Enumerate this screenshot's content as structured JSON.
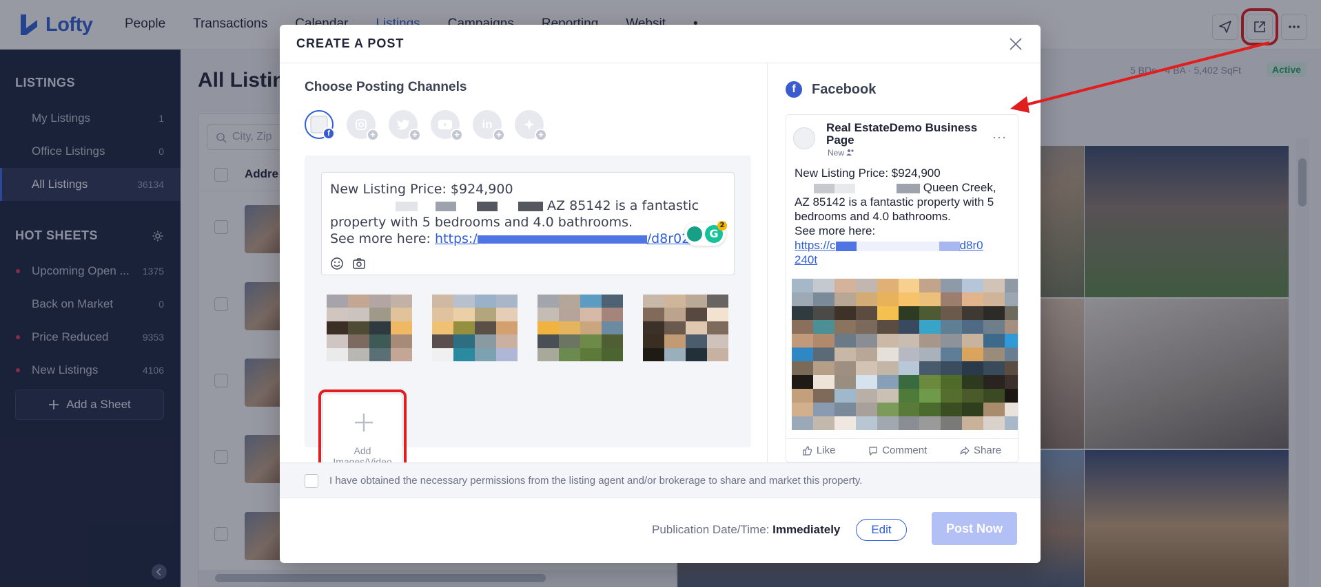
{
  "app": {
    "logo": "Lofty",
    "nav": [
      "People",
      "Transactions",
      "Calendar",
      "Listings",
      "Campaigns",
      "Reporting",
      "Websit"
    ],
    "nav_active": "Listings",
    "nav_more": "•"
  },
  "sidebar": {
    "listings_title": "LISTINGS",
    "listings": [
      {
        "label": "My Listings",
        "count": "1"
      },
      {
        "label": "Office Listings",
        "count": "0"
      },
      {
        "label": "All Listings",
        "count": "36134"
      }
    ],
    "hot_title": "HOT SHEETS",
    "hot_sheets": [
      {
        "label": "Upcoming Open ...",
        "count": "1375",
        "dot": true
      },
      {
        "label": "Back on Market",
        "count": "0",
        "dot": false
      },
      {
        "label": "Price Reduced",
        "count": "9353",
        "dot": true
      },
      {
        "label": "New Listings",
        "count": "4106",
        "dot": true
      }
    ],
    "add_sheet": "Add a Sheet"
  },
  "main": {
    "title": "All Listin",
    "search_placeholder": "City, Zip",
    "column_address": "Addre",
    "meta": "5 BDs · 4 BA · 5,402 SqFt",
    "status": "Active"
  },
  "modal": {
    "title": "CREATE A POST",
    "choose_channels": "Choose Posting Channels",
    "post_text": {
      "line1": "New Listing Price: $924,900",
      "line2_tail": "AZ 85142 is a fantastic",
      "line3": "property with 5 bedrooms and 4.0 bathrooms.",
      "line4_prefix": "See more here: ",
      "link_start": "https:/",
      "link_end": "/d8r024",
      "link_tail": "0t"
    },
    "add_media": "Add Images/Video",
    "permission": "I have obtained the necessary permissions from the listing agent and/or brokerage to share and market this property.",
    "publication_label": "Publication Date/Time: ",
    "publication_value": "Immediately",
    "edit": "Edit",
    "post_now": "Post Now",
    "grammarly_count": "2"
  },
  "preview": {
    "channel": "Facebook",
    "page_name": "Real EstateDemo Business Page",
    "page_sub": "New",
    "text1": "New Listing Price: $924,900",
    "text2_tail": "Queen Creek,",
    "text3": "AZ 85142 is a fantastic property with 5 bedrooms and 4.0 bathrooms.",
    "text4": "See more here:",
    "link_start": "https://c",
    "link_end": "d8r0",
    "link2": "240t",
    "actions": [
      "Like",
      "Comment",
      "Share"
    ]
  },
  "colors": {
    "accent": "#2f5fd8",
    "highlight": "#e21d1d",
    "sidebar_bg": "#1b2540"
  }
}
